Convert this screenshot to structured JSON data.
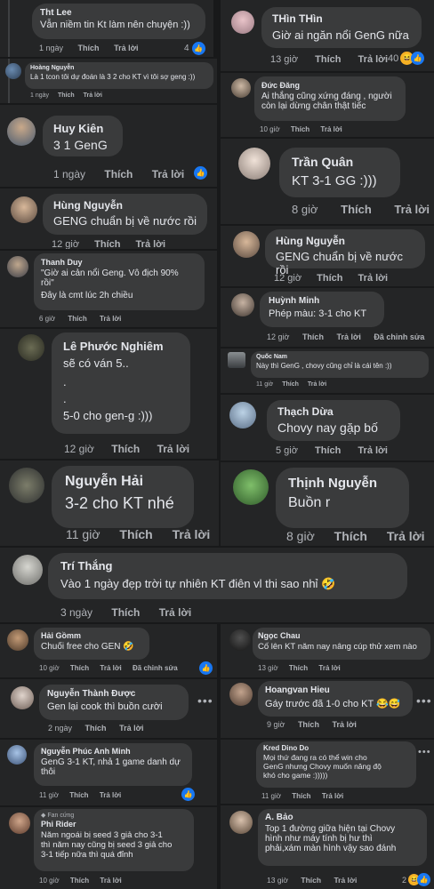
{
  "actions": {
    "time_like": "Thích",
    "reply": "Trả lời",
    "edited": "Đã chỉnh sửa"
  },
  "comments": [
    {
      "name": "Tht Lee",
      "text": "Vẫn niềm tin Kt làm nên chuyện :))",
      "time": "1 ngày",
      "count": "4"
    },
    {
      "name": "Hoàng Nguyễn",
      "text": "Là 1 tcon tôi dự đoán là 3 2 cho KT vì tôi sợ geng :))",
      "time": "1 ngày"
    },
    {
      "name": "Huy Kiên",
      "text": "3 1 GenG",
      "time": "1 ngày"
    },
    {
      "name": "Hùng Nguyễn",
      "text": "GENG chuẩn bị về nước rồi",
      "time": "12 giờ"
    },
    {
      "name": "Thanh Duy",
      "text1": "\"Giờ ai cản nổi Geng. Vô địch 90%",
      "text2": "rồi\"",
      "text3": "Đây là cmt lúc 2h chiều",
      "time": "6 giờ"
    },
    {
      "name": "Lê Phước Nghiêm",
      "text1": "sẽ có ván 5..",
      "text2": ".",
      "text3": ".",
      "text4": "5-0 cho gen-g :)))",
      "time": "12 giờ"
    },
    {
      "name": "Nguyễn Hải",
      "text": "3-2 cho KT nhé",
      "time": "11 giờ"
    },
    {
      "name": "THìn THìn",
      "text": "Giờ ai ngăn nổi GenG nữa",
      "time": "13 giờ",
      "count": "40"
    },
    {
      "name": "Đức Đăng",
      "text1": "Ai thắng cũng xứng đáng , người",
      "text2": "còn lại dừng chân thật tiếc",
      "time": "10 giờ"
    },
    {
      "name": "Trần Quân",
      "text": "KT 3-1 GG :)))",
      "time": "8 giờ"
    },
    {
      "name": "Hùng Nguyễn",
      "text": "GENG chuẩn bị về nước rồi",
      "time": "12 giờ"
    },
    {
      "name": "Huỳnh Minh",
      "text": "Phép màu: 3-1 cho KT",
      "time": "12 giờ"
    },
    {
      "name": "Quốc Nam",
      "text": "Này thì GenG , chovy cũng chỉ là cái tên :))",
      "time": "11 giờ"
    },
    {
      "name": "Thạch Dừa",
      "text": "Chovy nay gặp bố",
      "time": "5 giờ"
    },
    {
      "name": "Thịnh Nguyễn",
      "text": "Buồn r",
      "time": "8 giờ"
    },
    {
      "name": "Trí Thắng",
      "text": "Vào 1 ngày đẹp trời tự nhiên KT điên vl thi sao nhỉ",
      "time": "3 ngày"
    },
    {
      "name": "Hải Gồmm",
      "text": "Chuối free cho GEN",
      "time": "10 giờ"
    },
    {
      "name": "Nguyễn Thành Được",
      "text": "Gen lại cook thì buồn cười",
      "time": "2 ngày"
    },
    {
      "name": "Nguyễn Phúc Anh Minh",
      "text1": "GenG 3-1 KT, nhả 1 game danh dự",
      "text2": "thôi",
      "time": "11 giờ"
    },
    {
      "name": "Phi Rider",
      "badge": "Fan cứng",
      "text1": "Năm ngoái bị seed 3 giả cho 3-1",
      "text2": "thì năm nay cũng bị seed 3 giả cho",
      "text3": "3-1 tiếp nữa thì quá đỉnh",
      "time": "10 giờ"
    },
    {
      "name": "Ngọc Chau",
      "text": "Cố lên KT năm nay nâng cúp thử xem nào",
      "time": "13 giờ"
    },
    {
      "name": "Hoangvan Hieu",
      "text": "Gáy trước đã 1-0 cho KT",
      "time": "9 giờ"
    },
    {
      "name": "Kred Dino Do",
      "text1": "Mọi thứ đang ra có thể win cho",
      "text2": "GenG nhưng Chovy muốn nâng độ",
      "text3": "khó cho game :)))))",
      "time": "11 giờ"
    },
    {
      "name": "A. Bảo",
      "text1": "Top 1 đường giữa hiện tại Chovy",
      "text2": "hình như máy tính bị hư thì",
      "text3": "phải,xám màn hình vậy sao đánh",
      "time": "13 giờ",
      "count": "2"
    }
  ]
}
